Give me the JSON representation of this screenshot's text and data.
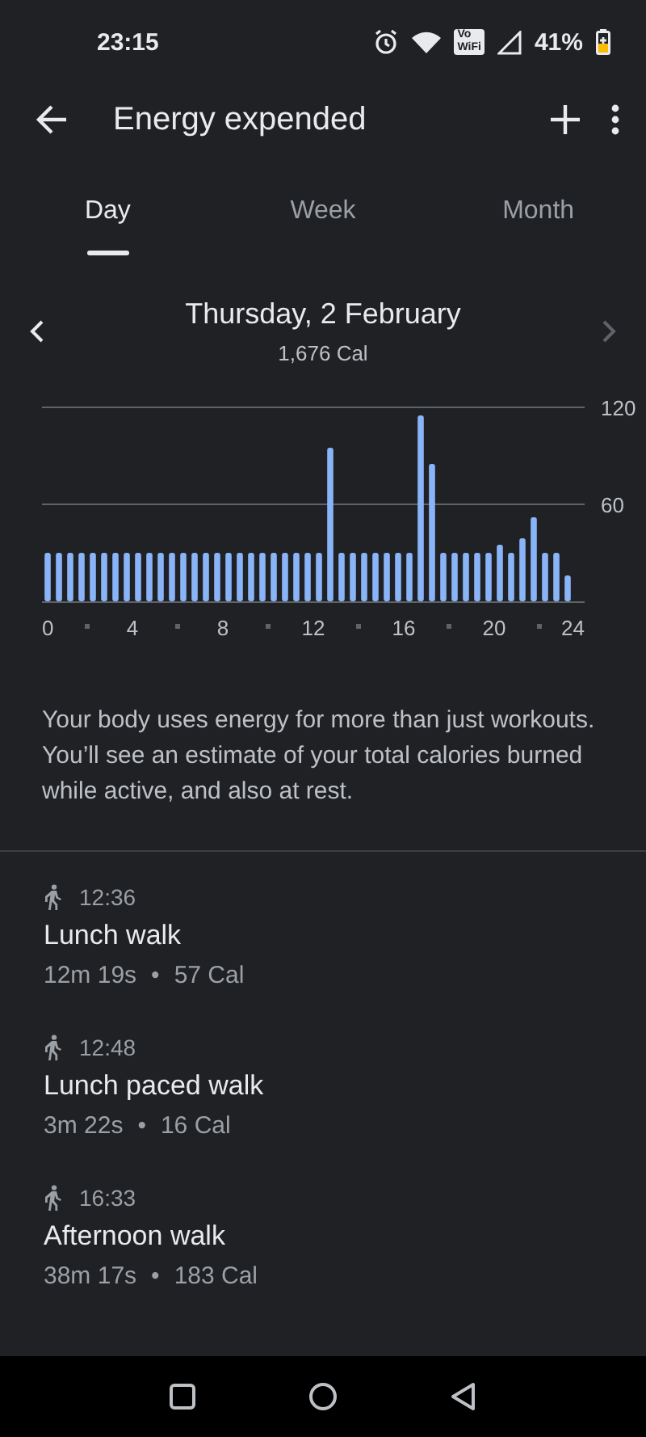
{
  "status_bar": {
    "time": "23:15",
    "vowifi": [
      "Vo",
      "WiFi"
    ],
    "battery": "41%"
  },
  "app_bar": {
    "title": "Energy expended"
  },
  "tabs": [
    {
      "label": "Day",
      "selected": true
    },
    {
      "label": "Week",
      "selected": false
    },
    {
      "label": "Month",
      "selected": false
    }
  ],
  "date_nav": {
    "date": "Thursday, 2 February",
    "total": "1,676 Cal",
    "prev_disabled": false,
    "next_disabled": true
  },
  "chart": {
    "chart_data": {
      "type": "bar",
      "x": [
        0.25,
        0.75,
        1.25,
        1.75,
        2.25,
        2.75,
        3.25,
        3.75,
        4.25,
        4.75,
        5.25,
        5.75,
        6.25,
        6.75,
        7.25,
        7.75,
        8.25,
        8.75,
        9.25,
        9.75,
        10.25,
        10.75,
        11.25,
        11.75,
        12.25,
        12.75,
        13.25,
        13.75,
        14.25,
        14.75,
        15.25,
        15.75,
        16.25,
        16.75,
        17.25,
        17.75,
        18.25,
        18.75,
        19.25,
        19.75,
        20.25,
        20.75,
        21.25,
        21.75,
        22.25,
        22.75,
        23.25
      ],
      "values": [
        30,
        30,
        30,
        30,
        30,
        30,
        30,
        30,
        30,
        30,
        30,
        30,
        30,
        30,
        30,
        30,
        30,
        30,
        30,
        30,
        30,
        30,
        30,
        30,
        30,
        95,
        30,
        30,
        30,
        30,
        30,
        30,
        30,
        115,
        85,
        30,
        30,
        30,
        30,
        30,
        35,
        30,
        39,
        52,
        30,
        30,
        16
      ],
      "xlim": [
        0,
        24
      ],
      "ylim": [
        0,
        120
      ],
      "xticks": [
        0,
        4,
        8,
        12,
        16,
        20,
        24
      ],
      "yticks": [
        60,
        120
      ]
    }
  },
  "description": "Your body uses energy for more than just workouts. You’ll see an estimate of your total calories burned while active, and also at rest.",
  "activities": [
    {
      "time": "12:36",
      "name": "Lunch walk",
      "duration": "12m 19s",
      "calories": "57 Cal"
    },
    {
      "time": "12:48",
      "name": "Lunch paced walk",
      "duration": "3m 22s",
      "calories": "16 Cal"
    },
    {
      "time": "16:33",
      "name": "Afternoon walk",
      "duration": "38m 17s",
      "calories": "183 Cal"
    }
  ],
  "separator": "•"
}
